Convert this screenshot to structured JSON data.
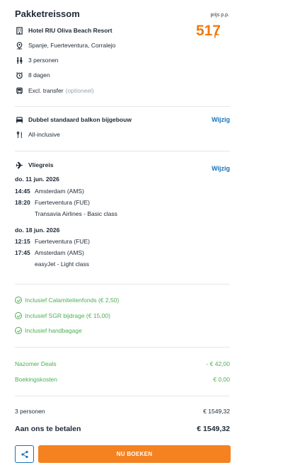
{
  "summary": {
    "title": "Pakketreissom",
    "price_label": "prijs p.p.",
    "price": "517",
    "price_suffix": ",-"
  },
  "details": {
    "hotel": "Hotel RIU Oliva Beach Resort",
    "location": "Spanje, Fuerteventura, Corralejo",
    "persons": "3 personen",
    "duration": "8 dagen",
    "transfer": "Excl. transfer",
    "transfer_note": "(optioneel)"
  },
  "room": {
    "name": "Dubbel standaard balkon bijgebouw",
    "board": "All-inclusive",
    "change_label": "Wijzig"
  },
  "flight": {
    "heading": "Vliegreis",
    "change_label": "Wijzig",
    "outbound": {
      "date": "do. 11 jun. 2026",
      "dep_time": "14:45",
      "dep_place": "Amsterdam (AMS)",
      "arr_time": "18:20",
      "arr_place": "Fuerteventura (FUE)",
      "carrier": "Transavia Airlines - Basic class"
    },
    "return": {
      "date": "do. 18 jun. 2026",
      "dep_time": "12:15",
      "dep_place": "Fuerteventura (FUE)",
      "arr_time": "17:45",
      "arr_place": "Amsterdam (AMS)",
      "carrier": "easyJet - Light class"
    }
  },
  "inclusions": [
    "Inclusief Calamiteitenfonds (€ 2,50)",
    "Inclusief SGR bijdrage (€ 15,00)",
    "Inclusief handbagage"
  ],
  "costs": {
    "deal_label": "Nazomer Deals",
    "deal_value": "- € 42,00",
    "booking_label": "Boekingskosten",
    "booking_value": "€ 0,00"
  },
  "totals": {
    "persons_label": "3 personen",
    "persons_value": "€ 1549,32",
    "pay_label": "Aan ons te betalen",
    "pay_value": "€ 1549,32"
  },
  "actions": {
    "book_label": "NU BOEKEN"
  },
  "colors": {
    "accent": "#f58220",
    "link": "#1a73b8",
    "success": "#4caf50"
  }
}
